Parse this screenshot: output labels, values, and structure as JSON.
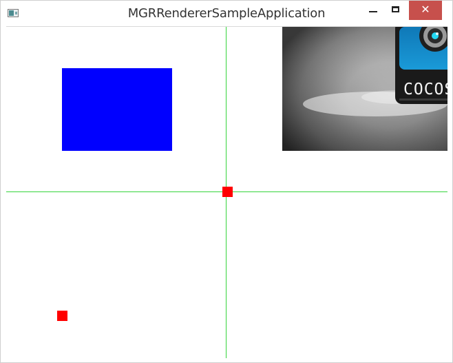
{
  "window": {
    "title": "MGRRendererSampleApplication",
    "icon": "app-window-icon",
    "controls": {
      "minimize_icon": "minimize-icon",
      "maximize_icon": "maximize-icon",
      "close_icon": "close-icon",
      "close_glyph": "✕",
      "close_color": "#c7504c"
    }
  },
  "scene": {
    "background_color": "#ffffff",
    "axis_line_color": "#34d43a",
    "blue_rect_color": "#0000ff",
    "red_square_color": "#ff0000",
    "sprite": {
      "logo_text": "COCOS"
    }
  }
}
